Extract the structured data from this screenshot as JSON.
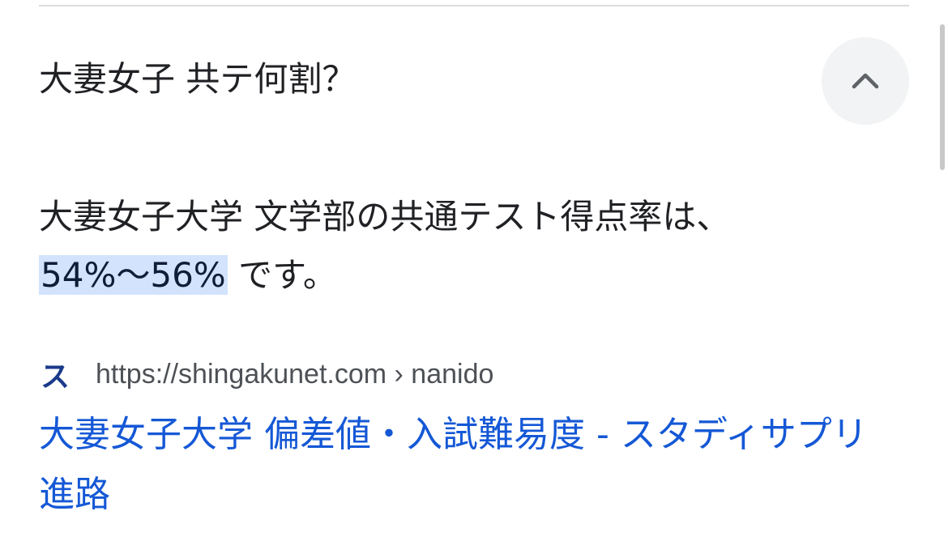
{
  "question": {
    "text": "大妻女子 共テ何割？"
  },
  "answer": {
    "line1": "大妻女子大学 文学部の共通テスト得点率は、",
    "highlight": "54%〜56%",
    "suffix": " です。"
  },
  "source": {
    "favicon_glyph": "ス",
    "url": "https://shingakunet.com › nanido"
  },
  "result": {
    "title": "大妻女子大学 偏差値・入試難易度 - スタディサプリ進路"
  },
  "icons": {
    "collapse": "chevron-up-icon",
    "favicon": "site-favicon-icon"
  },
  "colors": {
    "link": "#1558d6",
    "highlight": "#d3e3fd",
    "button_bg": "#f1f3f4"
  }
}
